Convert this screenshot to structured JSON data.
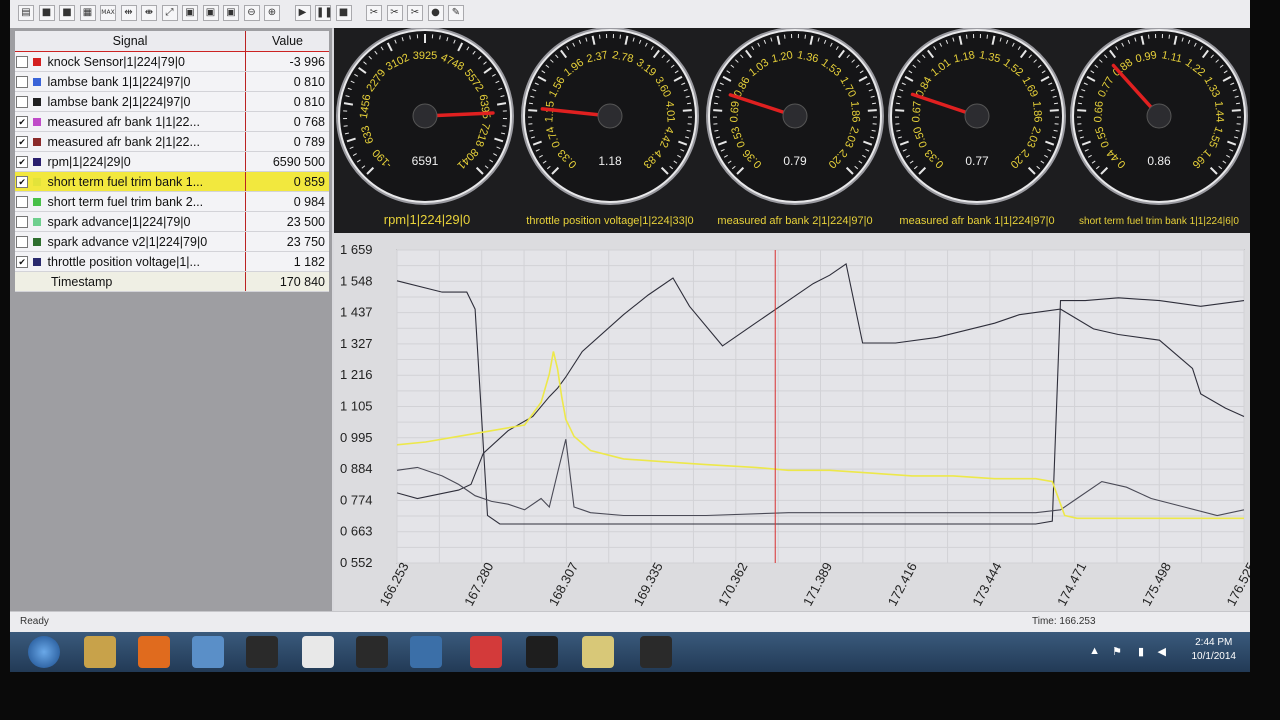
{
  "toolbar": {
    "buttons": [
      {
        "icon": "chart-icon",
        "glyph": "▤"
      },
      {
        "icon": "square-icon",
        "glyph": "■"
      },
      {
        "icon": "square-icon",
        "glyph": "■"
      },
      {
        "icon": "grid-icon",
        "glyph": "▦"
      },
      {
        "icon": "max-icon",
        "glyph": "MAX"
      },
      {
        "icon": "arrows-in-icon",
        "glyph": "⇹"
      },
      {
        "icon": "arrows-out-icon",
        "glyph": "⇼"
      },
      {
        "icon": "arrows-expand-icon",
        "glyph": "⤢"
      },
      {
        "icon": "box-icon",
        "glyph": "▣"
      },
      {
        "icon": "box-icon",
        "glyph": "▣"
      },
      {
        "icon": "box-icon",
        "glyph": "▣"
      },
      {
        "icon": "zoom-out-icon",
        "glyph": "⊖"
      },
      {
        "icon": "zoom-in-icon",
        "glyph": "⊕"
      },
      {
        "icon": "play-icon",
        "glyph": "▶"
      },
      {
        "icon": "pause-icon",
        "glyph": "❚❚"
      },
      {
        "icon": "stop-icon",
        "glyph": "■"
      },
      {
        "icon": "tool-icon",
        "glyph": "✂"
      },
      {
        "icon": "tool-icon",
        "glyph": "✂"
      },
      {
        "icon": "tool-icon",
        "glyph": "✂"
      },
      {
        "icon": "record-icon",
        "glyph": "●"
      },
      {
        "icon": "pen-icon",
        "glyph": "✎"
      }
    ]
  },
  "signals": {
    "header": {
      "signal": "Signal",
      "value": "Value"
    },
    "rows": [
      {
        "checked": false,
        "color": "#d42020",
        "name": "knock Sensor|1|224|79|0",
        "value": "-3 996"
      },
      {
        "checked": false,
        "color": "#3a64d8",
        "name": "lambse bank 1|1|224|97|0",
        "value": "0 810"
      },
      {
        "checked": false,
        "color": "#1f1f1f",
        "name": "lambse bank 2|1|224|97|0",
        "value": "0 810"
      },
      {
        "checked": true,
        "color": "#c04cc8",
        "name": "measured afr bank 1|1|22...",
        "value": "0 768"
      },
      {
        "checked": true,
        "color": "#8a2a2a",
        "name": "measured afr bank 2|1|22...",
        "value": "0 789"
      },
      {
        "checked": true,
        "color": "#2a1f6e",
        "name": "rpm|1|224|29|0",
        "value": "6590 500"
      },
      {
        "checked": true,
        "color": "#e3e33a",
        "name": "short term fuel trim bank 1...",
        "value": "0 859",
        "selected": true
      },
      {
        "checked": false,
        "color": "#48c048",
        "name": "short term fuel trim bank 2...",
        "value": "0 984"
      },
      {
        "checked": false,
        "color": "#6fcf8e",
        "name": "spark advance|1|224|79|0",
        "value": "23 500"
      },
      {
        "checked": false,
        "color": "#2e6e2e",
        "name": "spark advance v2|1|224|79|0",
        "value": "23 750"
      },
      {
        "checked": true,
        "color": "#2a2a6e",
        "name": "throttle position voltage|1|...",
        "value": "1 182"
      }
    ],
    "timestamp": {
      "name": "Timestamp",
      "value": "170 840"
    }
  },
  "gauges": [
    {
      "label": "rpm|1|224|29|0",
      "readout": "6591",
      "ticks": [
        "-190",
        "633",
        "1456",
        "2279",
        "3102",
        "3925",
        "4748",
        "5572",
        "6395",
        "7218",
        "8041"
      ],
      "value": 6591
    },
    {
      "label": "throttle position voltage|1|224|33|0",
      "readout": "1.18",
      "ticks": [
        "0.33",
        "0.74",
        "1.15",
        "1.56",
        "1.96",
        "2.37",
        "2.78",
        "3.19",
        "3.60",
        "4.01",
        "4.42",
        "4.83"
      ],
      "value": 1.18
    },
    {
      "label": "measured afr bank 2|1|224|97|0",
      "readout": "0.79",
      "ticks": [
        "0.36",
        "0.53",
        "0.69",
        "0.86",
        "1.03",
        "1.20",
        "1.36",
        "1.53",
        "1.70",
        "1.86",
        "2.03",
        "2.20"
      ],
      "value": 0.79
    },
    {
      "label": "measured afr bank 1|1|224|97|0",
      "readout": "0.77",
      "ticks": [
        "0.33",
        "0.50",
        "0.67",
        "0.84",
        "1.01",
        "1.18",
        "1.35",
        "1.52",
        "1.69",
        "1.86",
        "2.03",
        "2.20"
      ],
      "value": 0.77
    },
    {
      "label": "short term fuel trim bank 1|1|224|6|0",
      "readout": "0.86",
      "ticks": [
        "0.44",
        "0.55",
        "0.66",
        "0.77",
        "0.88",
        "0.99",
        "1.11",
        "1.22",
        "1.33",
        "1.44",
        "1.55",
        "1.66"
      ],
      "value": 0.86
    }
  ],
  "chart_data": {
    "type": "line",
    "y_ticks": [
      "1 659",
      "1 548",
      "1 437",
      "1 327",
      "1 216",
      "1 105",
      "0 995",
      "0 884",
      "0 774",
      "0 663",
      "0 552"
    ],
    "x_ticks": [
      "166.253",
      "167.280",
      "168.307",
      "169.335",
      "170.362",
      "171.389",
      "172.416",
      "173.444",
      "174.471",
      "175.498",
      "176.525"
    ],
    "ylim": [
      0.552,
      1.659
    ],
    "xlim": [
      166.253,
      176.525
    ],
    "cursor_x": 170.84,
    "series": [
      {
        "color": "#2e2e3a",
        "x": [
          166.253,
          166.5,
          167.0,
          167.15,
          167.3,
          167.6,
          167.9,
          168.1,
          168.2,
          168.3,
          168.5,
          169.0,
          169.3,
          169.6,
          169.8,
          170.2,
          170.6,
          171.0,
          171.3,
          171.5,
          171.7,
          171.9,
          172.3,
          172.8,
          173.5,
          173.8,
          174.3,
          174.7,
          175.0,
          175.5,
          175.9,
          176.0,
          176.3,
          176.525
        ],
        "y": [
          0.8,
          0.78,
          0.81,
          0.83,
          0.94,
          1.02,
          1.07,
          1.14,
          1.17,
          1.21,
          1.3,
          1.43,
          1.5,
          1.56,
          1.46,
          1.32,
          1.4,
          1.48,
          1.54,
          1.57,
          1.61,
          1.33,
          1.33,
          1.35,
          1.4,
          1.43,
          1.45,
          1.38,
          1.36,
          1.34,
          1.24,
          1.15,
          1.1,
          1.07
        ]
      },
      {
        "color": "#2e2e3a",
        "x": [
          166.253,
          166.8,
          167.1,
          167.2,
          167.35,
          167.5,
          168.0,
          168.5,
          169.5,
          170.5,
          171.5,
          172.5,
          173.5,
          174.0,
          174.2,
          174.3,
          174.4,
          174.6,
          175.0,
          175.5,
          176.0,
          176.525
        ],
        "y": [
          1.55,
          1.51,
          1.51,
          1.45,
          0.72,
          0.69,
          0.69,
          0.69,
          0.69,
          0.69,
          0.69,
          0.69,
          0.69,
          0.69,
          0.7,
          1.48,
          1.48,
          1.48,
          1.49,
          1.48,
          1.46,
          1.48
        ]
      },
      {
        "color": "#4a4a56",
        "x": [
          166.253,
          166.5,
          166.8,
          167.0,
          167.2,
          167.4,
          167.6,
          167.8,
          168.0,
          168.1,
          168.2,
          168.3,
          168.4,
          168.5,
          168.6,
          169.0,
          170.0,
          171.0,
          172.0,
          173.0,
          174.0,
          174.3,
          174.5,
          174.8,
          175.1,
          175.4,
          175.8,
          176.2,
          176.525
        ],
        "y": [
          0.88,
          0.89,
          0.86,
          0.83,
          0.79,
          0.77,
          0.76,
          0.74,
          0.78,
          0.75,
          0.87,
          0.99,
          0.75,
          0.74,
          0.73,
          0.72,
          0.72,
          0.73,
          0.73,
          0.73,
          0.73,
          0.74,
          0.78,
          0.84,
          0.82,
          0.78,
          0.75,
          0.72,
          0.74
        ]
      },
      {
        "color": "#ede84a",
        "x": [
          166.253,
          166.6,
          167.0,
          167.4,
          167.8,
          168.0,
          168.1,
          168.15,
          168.2,
          168.25,
          168.3,
          168.4,
          168.6,
          169.0,
          169.5,
          170.0,
          170.6,
          171.0,
          171.5,
          172.0,
          172.5,
          173.0,
          173.5,
          174.0,
          174.2,
          174.35,
          174.5,
          175.0,
          175.5,
          176.0,
          176.525
        ],
        "y": [
          0.97,
          0.98,
          1.0,
          1.02,
          1.04,
          1.12,
          1.22,
          1.3,
          1.24,
          1.14,
          1.06,
          1.0,
          0.95,
          0.92,
          0.91,
          0.9,
          0.89,
          0.88,
          0.88,
          0.87,
          0.86,
          0.86,
          0.85,
          0.85,
          0.84,
          0.72,
          0.71,
          0.71,
          0.71,
          0.71,
          0.71
        ]
      }
    ]
  },
  "status": {
    "left": "Ready",
    "time": "Time: 166.253"
  },
  "taskbar": {
    "apps": [
      "start-orb-icon",
      "folder-icon",
      "firefox-icon",
      "app-icon",
      "ect-icon",
      "app-icon",
      "app-icon",
      "app-icon",
      "app-icon",
      "app-icon",
      "eye-icon",
      "ect-icon"
    ],
    "time": "2:44 PM",
    "date": "10/1/2014"
  }
}
